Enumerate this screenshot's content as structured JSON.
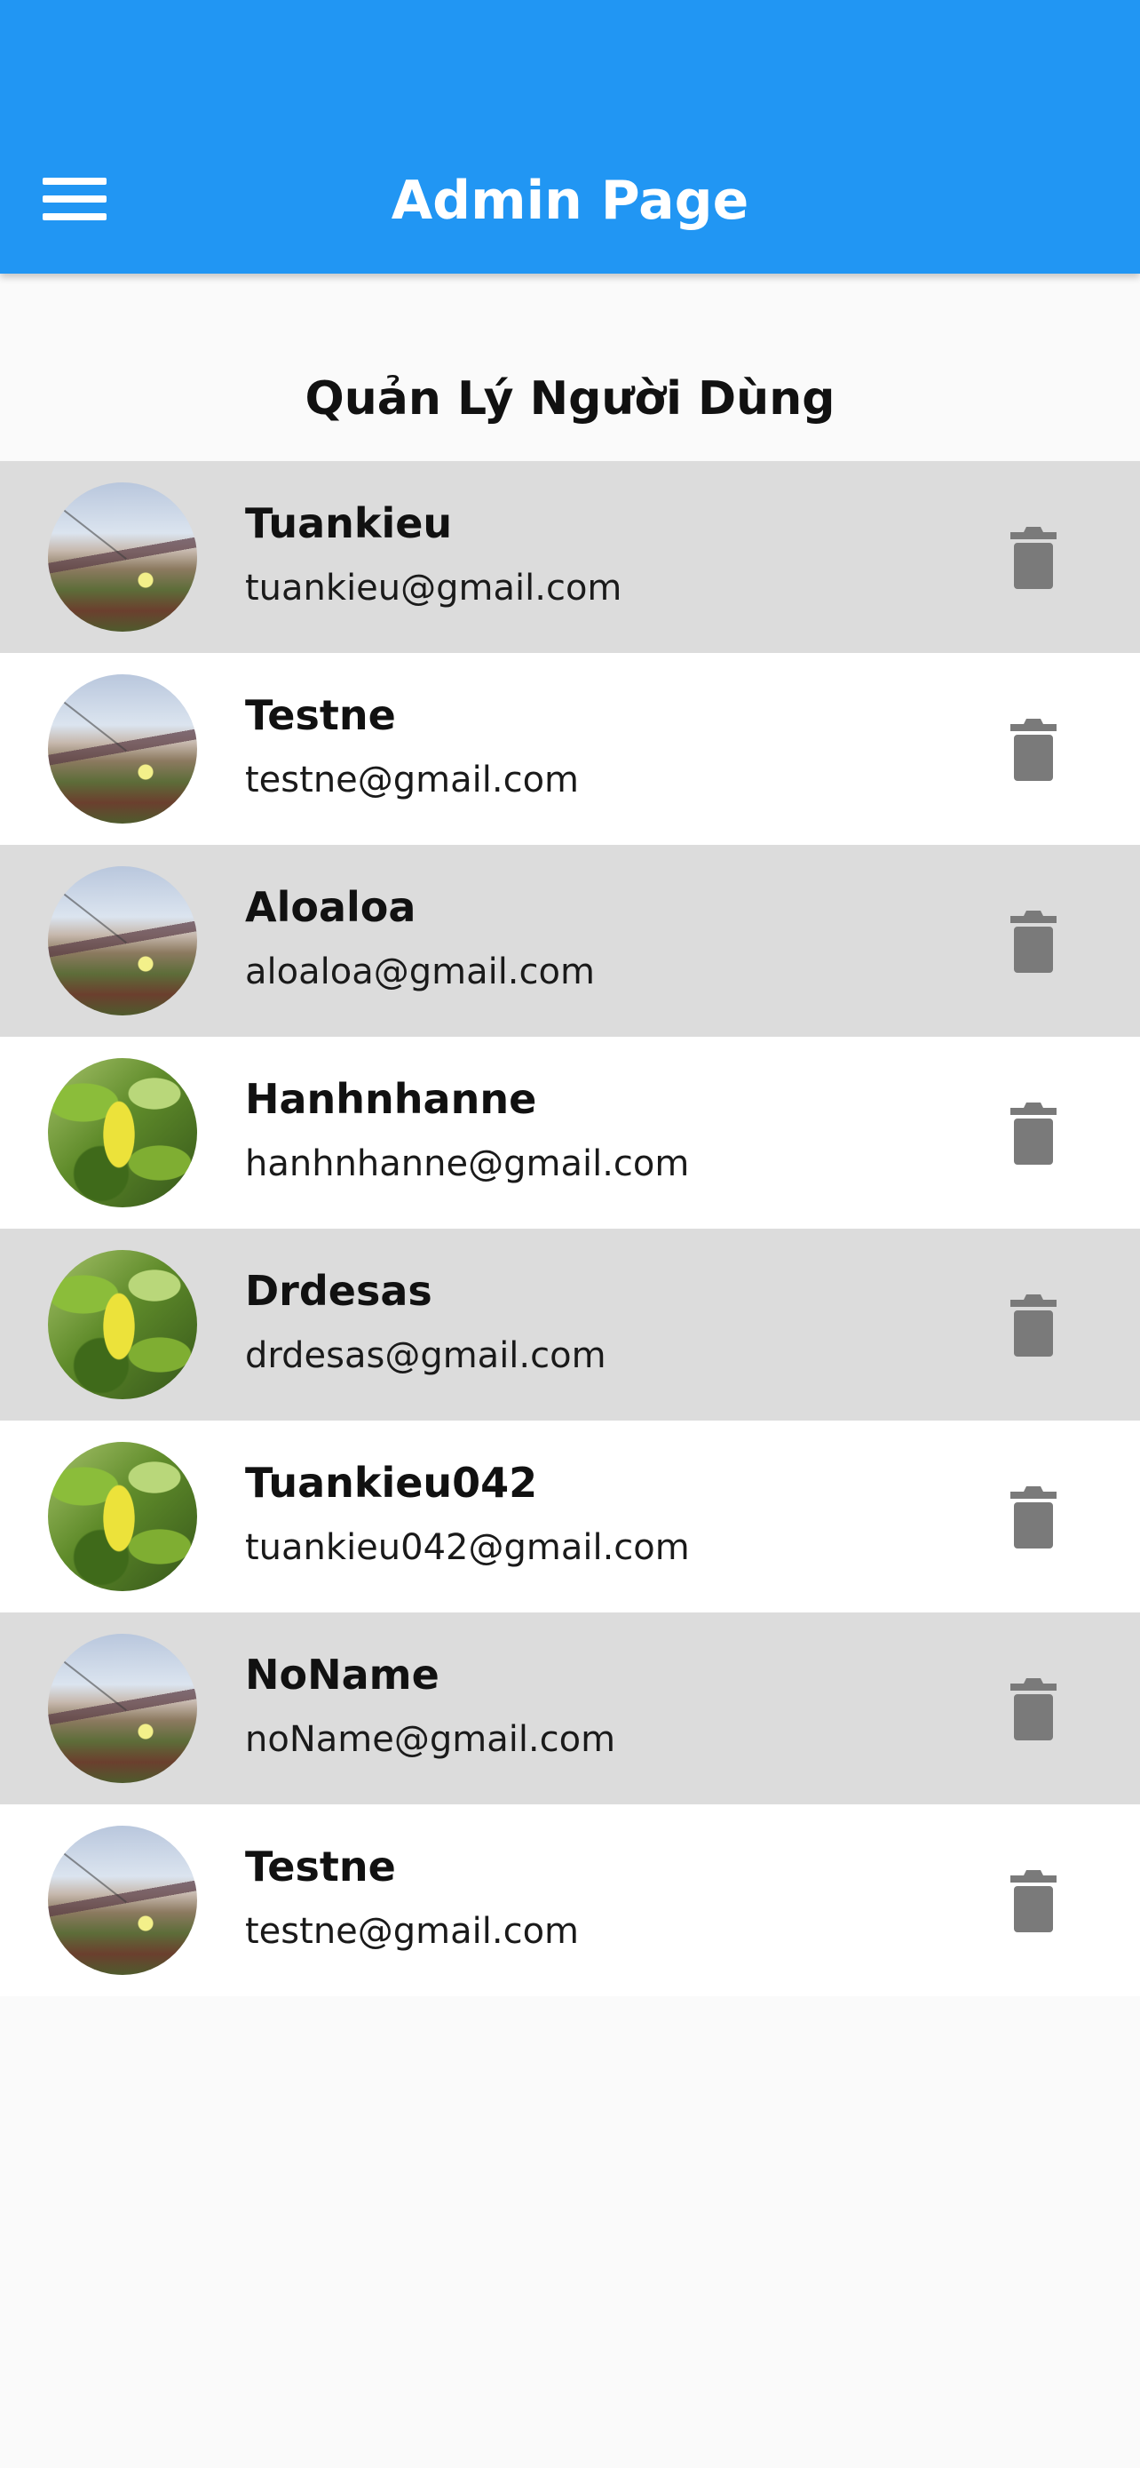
{
  "app_bar": {
    "title": "Admin Page",
    "menu_icon": "menu-icon",
    "color": "#2196f3"
  },
  "page": {
    "heading": "Quản Lý Người Dùng"
  },
  "delete_icon": "trash-icon",
  "users": [
    {
      "name": "Tuankieu",
      "email": "tuankieu@gmail.com",
      "avatar": "field-photo"
    },
    {
      "name": "Testne",
      "email": "testne@gmail.com",
      "avatar": "field-photo"
    },
    {
      "name": "Aloaloa",
      "email": "aloaloa@gmail.com",
      "avatar": "field-photo"
    },
    {
      "name": "Hanhnhanne",
      "email": "hanhnhanne@gmail.com",
      "avatar": "leaf-photo"
    },
    {
      "name": "Drdesas",
      "email": "drdesas@gmail.com",
      "avatar": "leaf-photo"
    },
    {
      "name": "Tuankieu042",
      "email": "tuankieu042@gmail.com",
      "avatar": "leaf-photo"
    },
    {
      "name": "NoName",
      "email": "noName@gmail.com",
      "avatar": "field-photo"
    },
    {
      "name": "Testne",
      "email": "testne@gmail.com",
      "avatar": "field-photo"
    }
  ]
}
